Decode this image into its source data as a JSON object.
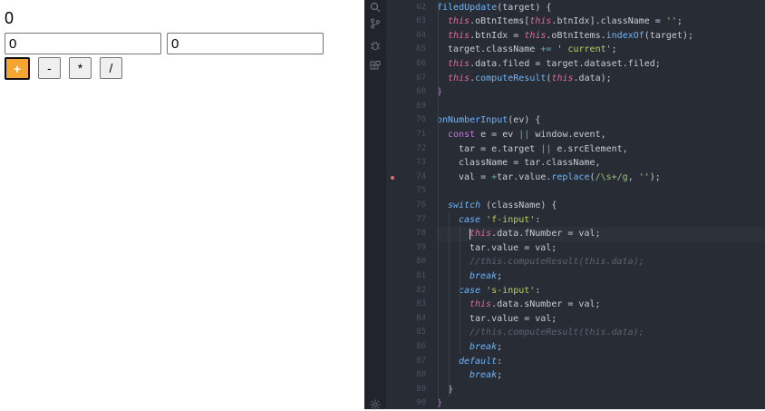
{
  "calculator": {
    "result": "0",
    "first_value": "0",
    "second_value": "0",
    "operators": [
      {
        "label": "+",
        "current": true
      },
      {
        "label": "-",
        "current": false
      },
      {
        "label": "*",
        "current": false
      },
      {
        "label": "/",
        "current": false
      }
    ],
    "accent_color": "#f5a631"
  },
  "editor": {
    "activity_icons": [
      "search-icon",
      "source-control-icon",
      "debug-icon",
      "extensions-icon",
      "settings-gear-icon"
    ],
    "breakpoint_line": 74,
    "active_line": 78,
    "lines": [
      {
        "n": 62,
        "indent": 0,
        "tokens": [
          [
            "fn",
            "filedUpdate"
          ],
          [
            "var",
            "(target) {"
          ]
        ]
      },
      {
        "n": 63,
        "indent": 1,
        "tokens": [
          [
            "this",
            "this"
          ],
          [
            "var",
            ".oBtnItems["
          ],
          [
            "this",
            "this"
          ],
          [
            "var",
            ".btnIdx].className = "
          ],
          [
            "str",
            "''"
          ],
          [
            "var",
            ";"
          ]
        ]
      },
      {
        "n": 64,
        "indent": 1,
        "tokens": [
          [
            "this",
            "this"
          ],
          [
            "var",
            ".btnIdx = "
          ],
          [
            "this",
            "this"
          ],
          [
            "var",
            ".oBtnItems."
          ],
          [
            "fn",
            "indexOf"
          ],
          [
            "var",
            "(target);"
          ]
        ]
      },
      {
        "n": 65,
        "indent": 1,
        "tokens": [
          [
            "var",
            "target.className "
          ],
          [
            "op",
            "+="
          ],
          [
            "var",
            " "
          ],
          [
            "str",
            "' current'"
          ],
          [
            "var",
            ";"
          ]
        ]
      },
      {
        "n": 66,
        "indent": 1,
        "tokens": [
          [
            "this",
            "this"
          ],
          [
            "var",
            ".data.filed = target.dataset.filed;"
          ]
        ]
      },
      {
        "n": 67,
        "indent": 1,
        "tokens": [
          [
            "this",
            "this"
          ],
          [
            "var",
            "."
          ],
          [
            "fn",
            "computeResult"
          ],
          [
            "var",
            "("
          ],
          [
            "this",
            "this"
          ],
          [
            "var",
            ".data);"
          ]
        ]
      },
      {
        "n": 68,
        "indent": 0,
        "tokens": [
          [
            "kw",
            "}"
          ]
        ]
      },
      {
        "n": 69,
        "indent": 0,
        "tokens": []
      },
      {
        "n": 70,
        "indent": 0,
        "tokens": [
          [
            "fn",
            "onNumberInput"
          ],
          [
            "var",
            "(ev) {"
          ]
        ]
      },
      {
        "n": 71,
        "indent": 1,
        "tokens": [
          [
            "kw",
            "const"
          ],
          [
            "var",
            " e = ev "
          ],
          [
            "op",
            "||"
          ],
          [
            "var",
            " window.event,"
          ]
        ]
      },
      {
        "n": 72,
        "indent": 2,
        "tokens": [
          [
            "var",
            "tar = e.target "
          ],
          [
            "op",
            "||"
          ],
          [
            "var",
            " e.srcElement,"
          ]
        ]
      },
      {
        "n": 73,
        "indent": 2,
        "tokens": [
          [
            "var",
            "className = tar.className,"
          ]
        ]
      },
      {
        "n": 74,
        "indent": 2,
        "tokens": [
          [
            "var",
            "val = "
          ],
          [
            "op",
            "+"
          ],
          [
            "var",
            "tar.value."
          ],
          [
            "fn",
            "replace"
          ],
          [
            "var",
            "("
          ],
          [
            "rx",
            "/\\s+/g"
          ],
          [
            "var",
            ", "
          ],
          [
            "str",
            "''"
          ],
          [
            "var",
            ");"
          ]
        ]
      },
      {
        "n": 75,
        "indent": 0,
        "tokens": []
      },
      {
        "n": 76,
        "indent": 1,
        "tokens": [
          [
            "kwi",
            "switch"
          ],
          [
            "var",
            " (className) {"
          ]
        ]
      },
      {
        "n": 77,
        "indent": 2,
        "tokens": [
          [
            "kwi",
            "case"
          ],
          [
            "var",
            " "
          ],
          [
            "str",
            "'f-input'"
          ],
          [
            "var",
            ":"
          ]
        ]
      },
      {
        "n": 78,
        "indent": 3,
        "tokens": [
          [
            "this",
            "this"
          ],
          [
            "var",
            ".data.fNumber = val;"
          ]
        ]
      },
      {
        "n": 79,
        "indent": 3,
        "tokens": [
          [
            "var",
            "tar.value = val;"
          ]
        ]
      },
      {
        "n": 80,
        "indent": 3,
        "tokens": [
          [
            "cm",
            "//this.computeResult(this.data);"
          ]
        ]
      },
      {
        "n": 81,
        "indent": 3,
        "tokens": [
          [
            "kwi",
            "break"
          ],
          [
            "var",
            ";"
          ]
        ]
      },
      {
        "n": 82,
        "indent": 2,
        "tokens": [
          [
            "kwi",
            "case"
          ],
          [
            "var",
            " "
          ],
          [
            "str",
            "'s-input'"
          ],
          [
            "var",
            ":"
          ]
        ]
      },
      {
        "n": 83,
        "indent": 3,
        "tokens": [
          [
            "this",
            "this"
          ],
          [
            "var",
            ".data.sNumber = val;"
          ]
        ]
      },
      {
        "n": 84,
        "indent": 3,
        "tokens": [
          [
            "var",
            "tar.value = val;"
          ]
        ]
      },
      {
        "n": 85,
        "indent": 3,
        "tokens": [
          [
            "cm",
            "//this.computeResult(this.data);"
          ]
        ]
      },
      {
        "n": 86,
        "indent": 3,
        "tokens": [
          [
            "kwi",
            "break"
          ],
          [
            "var",
            ";"
          ]
        ]
      },
      {
        "n": 87,
        "indent": 2,
        "tokens": [
          [
            "kwi",
            "default"
          ],
          [
            "var",
            ":"
          ]
        ]
      },
      {
        "n": 88,
        "indent": 3,
        "tokens": [
          [
            "kwi",
            "break"
          ],
          [
            "var",
            ";"
          ]
        ]
      },
      {
        "n": 89,
        "indent": 1,
        "tokens": [
          [
            "var",
            "}"
          ]
        ]
      },
      {
        "n": 90,
        "indent": 0,
        "tokens": [
          [
            "kw",
            "}"
          ]
        ]
      }
    ]
  }
}
